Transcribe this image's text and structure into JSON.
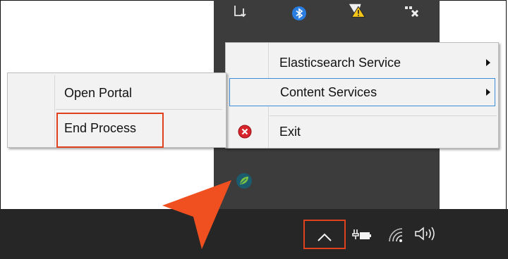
{
  "context_menu": {
    "items": [
      {
        "label": "Elasticsearch Service",
        "has_submenu": true
      },
      {
        "label": "Content Services",
        "has_submenu": true
      },
      {
        "label": "Exit",
        "has_submenu": false
      }
    ]
  },
  "submenu": {
    "items": [
      {
        "label": "Open Portal"
      },
      {
        "label": "End Process"
      }
    ]
  },
  "tray_overflow_icons": [
    "usb-icon",
    "bluetooth-icon",
    "warning-icon",
    "network-disconnected-icon",
    "app-leaf-icon"
  ],
  "taskbar_icons": [
    "chevron-up-icon",
    "battery-icon",
    "wifi-icon",
    "volume-icon"
  ],
  "colors": {
    "highlight": "#e0401c",
    "pointer": "#f05020",
    "taskbar": "#262626",
    "tray_overflow": "#3c3c3c",
    "menu_bg": "#f2f2f2",
    "menu_hover_border": "#3b8cd9"
  }
}
